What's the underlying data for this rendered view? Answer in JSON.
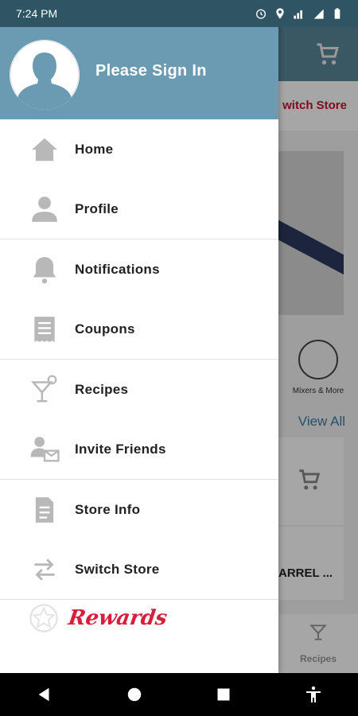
{
  "status_bar": {
    "time": "7:24 PM",
    "icons": [
      "alarm-icon",
      "location-icon",
      "signal-icon",
      "lte-icon",
      "battery-icon"
    ]
  },
  "background": {
    "switch_store": "witch Store",
    "mixers_label": "Mixers & More",
    "view_all": "View All",
    "product_partial": "ARREL ...",
    "tab_recipes": "Recipes"
  },
  "drawer": {
    "sign_in": "Please Sign In",
    "items": [
      {
        "label": "Home",
        "icon": "home-icon"
      },
      {
        "label": "Profile",
        "icon": "profile-icon"
      },
      {
        "label": "Notifications",
        "icon": "bell-icon"
      },
      {
        "label": "Coupons",
        "icon": "coupon-icon"
      },
      {
        "label": "Recipes",
        "icon": "cocktail-icon"
      },
      {
        "label": "Invite Friends",
        "icon": "invite-icon"
      },
      {
        "label": "Store Info",
        "icon": "store-info-icon"
      },
      {
        "label": "Switch Store",
        "icon": "switch-icon"
      }
    ],
    "rewards": "Rewards"
  },
  "colors": {
    "header": "#6a9bb3",
    "status_bar": "#2f5464",
    "icon_gray": "#b8b8b8",
    "rewards_red": "#d81e3a"
  }
}
